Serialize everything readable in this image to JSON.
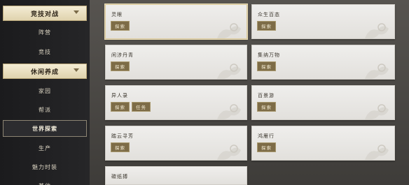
{
  "sidebar": {
    "section1": {
      "label": "竞技对战"
    },
    "items": [
      {
        "label": "阵营"
      },
      {
        "label": "竞技"
      }
    ],
    "section2": {
      "label": "休闲养成"
    },
    "items2": [
      {
        "label": "家园"
      },
      {
        "label": "帮派"
      },
      {
        "label": "世界探索"
      },
      {
        "label": "生产"
      },
      {
        "label": "魅力时装"
      },
      {
        "label": "其他"
      }
    ]
  },
  "cards": [
    {
      "title": "灵眼",
      "tags": [
        "探索"
      ]
    },
    {
      "title": "众生百态",
      "tags": [
        "探索"
      ]
    },
    {
      "title": "闲涉丹青",
      "tags": [
        "探索"
      ]
    },
    {
      "title": "集纳万物",
      "tags": [
        "探索"
      ]
    },
    {
      "title": "异人录",
      "tags": [
        "探索",
        "任务"
      ]
    },
    {
      "title": "百景游",
      "tags": [
        "探索"
      ]
    },
    {
      "title": "踏云寻芳",
      "tags": [
        "探索"
      ]
    },
    {
      "title": "鸿雁行",
      "tags": [
        "探索"
      ]
    },
    {
      "title": "碳纸搏",
      "tags": []
    }
  ]
}
